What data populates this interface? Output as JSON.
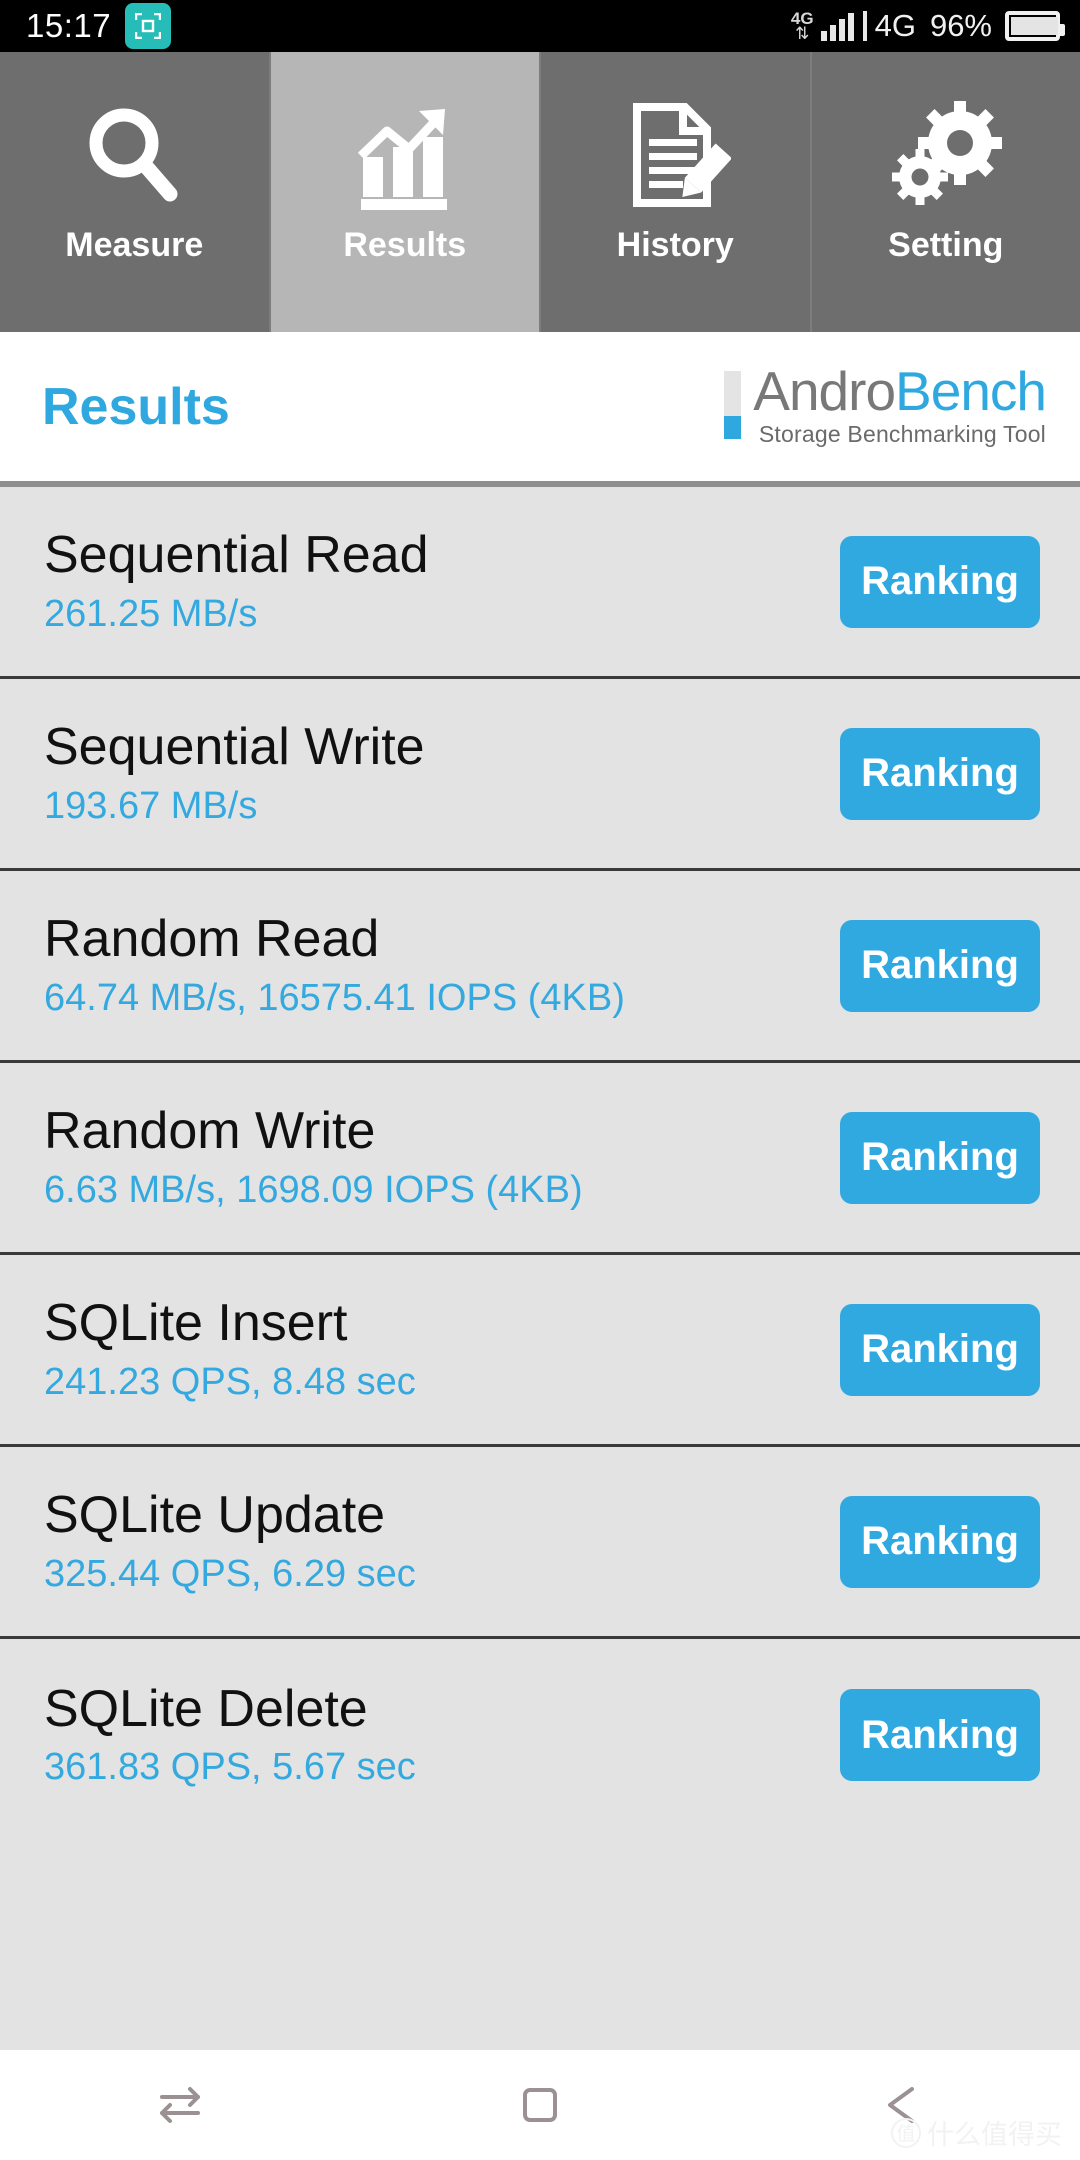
{
  "statusbar": {
    "time": "15:17",
    "badge_icon": "screen-capture-icon",
    "network_small_label": "4G",
    "network_label": "4G",
    "battery_percent": "96%",
    "signal_icon": "signal-bars-icon",
    "battery_icon": "battery-icon",
    "data_transfer_icon": "data-updown-icon"
  },
  "tabs": [
    {
      "label": "Measure",
      "icon": "magnifier-icon",
      "active": false
    },
    {
      "label": "Results",
      "icon": "bar-chart-growth-icon",
      "active": true
    },
    {
      "label": "History",
      "icon": "document-pencil-icon",
      "active": false
    },
    {
      "label": "Setting",
      "icon": "gears-icon",
      "active": false
    }
  ],
  "header": {
    "page_title": "Results",
    "logo_part1": "Andro",
    "logo_part2": "Bench",
    "logo_tagline": "Storage Benchmarking Tool"
  },
  "colors": {
    "accent_blue": "#2fa9e0",
    "value_blue": "#33a9e0",
    "list_bg": "#e3e3e3",
    "tab_bg": "#6e6e6e",
    "tab_active_bg": "#b6b6b6",
    "status_badge": "#26bdb8"
  },
  "results": {
    "ranking_label": "Ranking",
    "rows": [
      {
        "title": "Sequential Read",
        "value": "261.25 MB/s"
      },
      {
        "title": "Sequential Write",
        "value": "193.67 MB/s"
      },
      {
        "title": "Random Read",
        "value": "64.74 MB/s, 16575.41 IOPS (4KB)"
      },
      {
        "title": "Random Write",
        "value": "6.63 MB/s, 1698.09 IOPS (4KB)"
      },
      {
        "title": "SQLite Insert",
        "value": "241.23 QPS, 8.48 sec"
      },
      {
        "title": "SQLite Update",
        "value": "325.44 QPS, 6.29 sec"
      },
      {
        "title": "SQLite Delete",
        "value": "361.83 QPS, 5.67 sec"
      }
    ]
  },
  "navbar": {
    "buttons": [
      {
        "icon": "switch-apps-icon"
      },
      {
        "icon": "home-square-icon"
      },
      {
        "icon": "back-arrow-icon"
      }
    ]
  },
  "watermark": {
    "mark": "值",
    "text": "什么值得买"
  }
}
